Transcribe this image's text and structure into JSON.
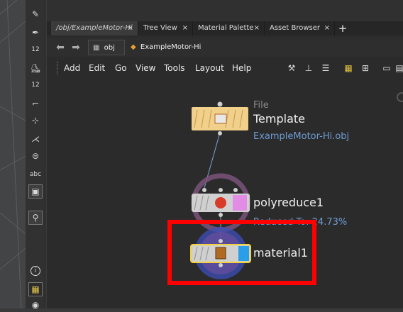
{
  "tabs": [
    {
      "label": "/obj/ExampleMotor-Hi",
      "close": "×",
      "active": true
    },
    {
      "label": "Tree View",
      "close": "×",
      "active": false
    },
    {
      "label": "Material Palette",
      "close": "×",
      "active": false
    },
    {
      "label": "Asset Browser",
      "close": "×",
      "active": false
    }
  ],
  "add_tab": "+",
  "path": {
    "root": "obj",
    "child": "ExampleMotor-Hi"
  },
  "menu": [
    "Add",
    "Edit",
    "Go",
    "View",
    "Tools",
    "Layout",
    "Help"
  ],
  "toolstrip": {
    "number_badge": "12",
    "number_badge2": "12",
    "abc_label": "abc",
    "info_label": "i"
  },
  "nodes": {
    "file": {
      "type": "File",
      "name": "Template",
      "subtitle": "ExampleMotor-Hi.obj"
    },
    "polyreduce": {
      "name": "polyreduce1",
      "subtitle": "Reduced To: 24.73%"
    },
    "material": {
      "name": "material1"
    }
  },
  "colors": {
    "node_file": "#f0d08a",
    "node_gray": "#d0d0d0",
    "poly_pink": "#e28ce6",
    "material_blue": "#2a9ee8",
    "highlight": "#ff0000",
    "link_blue": "#6f9cd4"
  },
  "icons": [
    "back-arrow-icon",
    "forward-arrow-icon",
    "wrench-icon",
    "tree-icon",
    "list-icon",
    "palette-icon",
    "grid-icon",
    "screen-icon"
  ]
}
